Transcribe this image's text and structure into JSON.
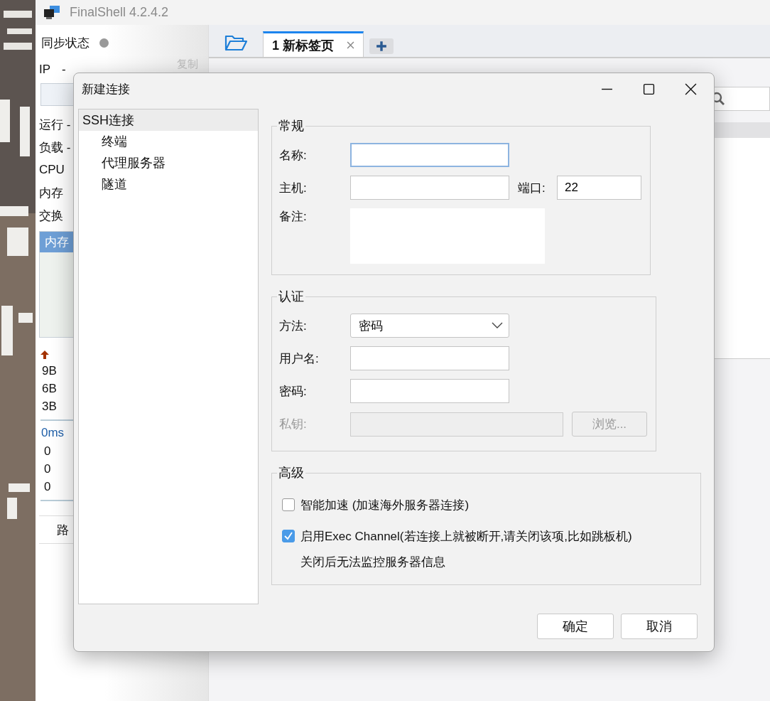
{
  "app": {
    "title": "FinalShell 4.2.4.2"
  },
  "left_panel": {
    "sync_label": "同步状态",
    "sync_connected": false,
    "ip_label": "IP",
    "ip_value": "-",
    "copy": "复制",
    "stats": [
      {
        "label": "运行 -"
      },
      {
        "label": "负载 -"
      },
      {
        "label": "CPU"
      },
      {
        "label": "内存"
      },
      {
        "label": "交换"
      }
    ],
    "graph_tab": "内存",
    "traffic": [
      "9B",
      "6B",
      "3B"
    ],
    "latency": "0ms",
    "ping_rows": [
      "0",
      "0",
      "0"
    ],
    "bottom_tab": "路"
  },
  "tabs": [
    {
      "label": "1 新标签页",
      "selected": true
    }
  ],
  "dialog": {
    "title": "新建连接",
    "tree": [
      {
        "label": "SSH连接",
        "selected": true,
        "children": [
          {
            "label": "终端",
            "selected": false
          },
          {
            "label": "代理服务器",
            "selected": false
          },
          {
            "label": "隧道",
            "selected": false
          }
        ]
      }
    ],
    "general": {
      "title": "常规",
      "name_label": "名称:",
      "name_focused": true,
      "host_label": "主机:",
      "port_label": "端口:",
      "port_value": "22",
      "note_label": "备注:"
    },
    "auth": {
      "title": "认证",
      "method_label": "方法:",
      "method_value": "密码",
      "user_label": "用户名:",
      "password_label": "密码:",
      "key_label": "私钥:",
      "key_disabled": true,
      "browse": "浏览..."
    },
    "advanced": {
      "title": "高级",
      "options": [
        {
          "label": "智能加速 (加速海外服务器连接)",
          "checked": false
        },
        {
          "label": "启用Exec Channel(若连接上就被断开,请关闭该项,比如跳板机)",
          "checked": true
        }
      ],
      "note": "关闭后无法监控服务器信息"
    },
    "buttons": [
      "确定",
      "取消"
    ]
  }
}
